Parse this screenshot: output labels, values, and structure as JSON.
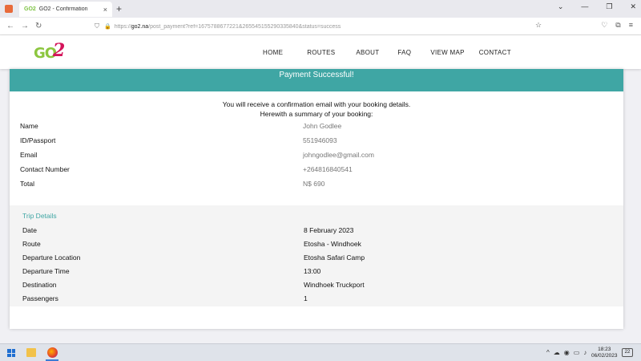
{
  "browser": {
    "tab_title": "GO2 - Confirmation",
    "tab_favicon": "GO2",
    "new_tab": "+",
    "url_prefix": "https://",
    "url_host": "go2.na",
    "url_path": "/post_payment?ref=1675788677221&265545155290335840&status=success",
    "icons": [
      "back-icon",
      "forward-icon",
      "reload-icon",
      "shield-icon",
      "lock-icon",
      "star-icon",
      "pocket-icon",
      "extensions-icon",
      "menu-icon"
    ]
  },
  "site": {
    "logo_text_a": "GO",
    "logo_text_b": "2",
    "colors": {
      "accent": "#3fa6a4",
      "logo_green": "#8cc63f",
      "logo_pink": "#d4145a"
    },
    "menu": [
      "HOME",
      "ROUTES",
      "ABOUT",
      "FAQ",
      "VIEW MAP",
      "CONTACT"
    ]
  },
  "confirmation": {
    "banner": "Payment Successful!",
    "intro_line1": "You will receive a confirmation email with your booking details.",
    "intro_line2": "Herewith a summary of your booking:",
    "summary": [
      {
        "label": "Name",
        "value": "John Godlee"
      },
      {
        "label": "ID/Passport",
        "value": "551946093"
      },
      {
        "label": "Email",
        "value": "johngodlee@gmail.com"
      },
      {
        "label": "Contact Number",
        "value": "+264816840541"
      },
      {
        "label": "Total",
        "value": "N$ 690"
      }
    ]
  },
  "trip": {
    "title": "Trip Details",
    "rows": [
      {
        "label": "Date",
        "value": "8 February 2023"
      },
      {
        "label": "Route",
        "value": "Etosha - Windhoek"
      },
      {
        "label": "Departure Location",
        "value": "Etosha Safari Camp"
      },
      {
        "label": "Departure Time",
        "value": "13:00"
      },
      {
        "label": "Destination",
        "value": "Windhoek Truckport"
      },
      {
        "label": "Passengers",
        "value": "1"
      }
    ]
  },
  "taskbar": {
    "time": "18:23",
    "date": "06/02/2023",
    "notifications": "22"
  }
}
